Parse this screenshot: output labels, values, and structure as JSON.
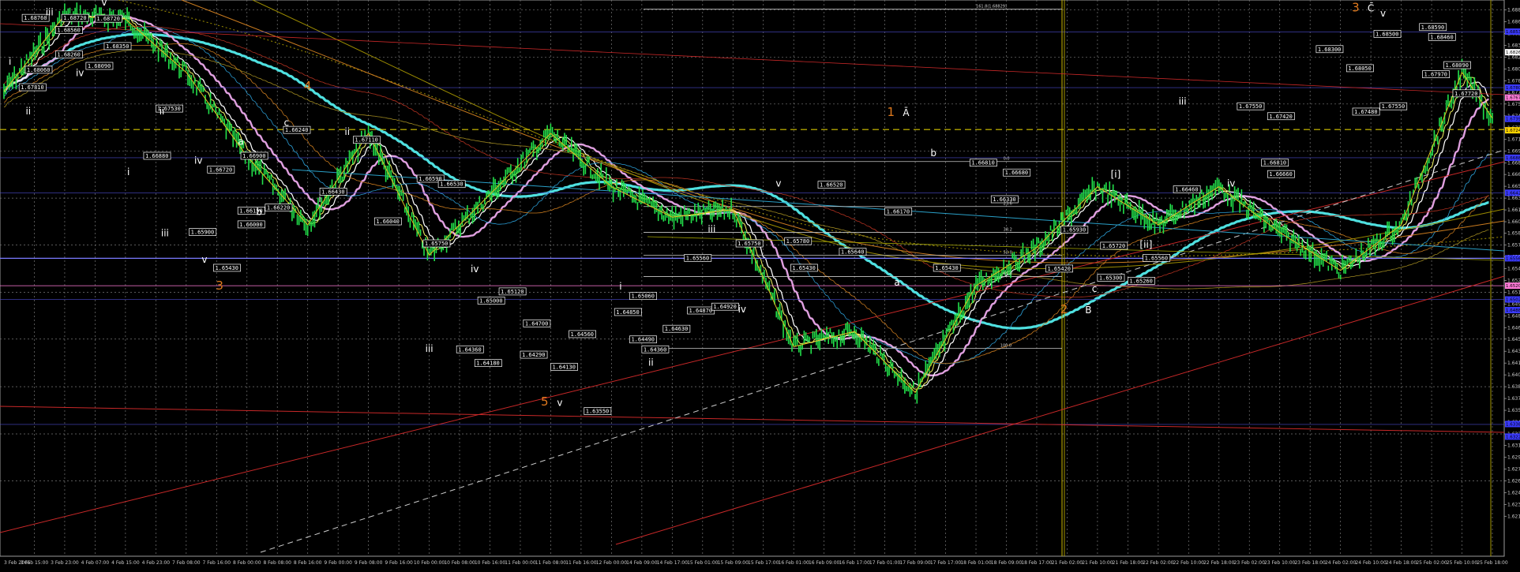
{
  "chart_data": {
    "type": "line",
    "instrument": "GBPUSD-style forex chart (Elliott wave annotated)",
    "xlabel": "",
    "ylabel": "",
    "ylim": [
      1.6165,
      1.6895
    ],
    "grid": true,
    "x_ticks": [
      "3 Feb 2005",
      "3 Feb 15:00",
      "3 Feb 23:00",
      "4 Feb 07:00",
      "4 Feb 15:00",
      "4 Feb 23:00",
      "7 Feb 08:00",
      "7 Feb 16:00",
      "8 Feb 00:00",
      "8 Feb 08:00",
      "8 Feb 16:00",
      "9 Feb 00:00",
      "9 Feb 08:00",
      "9 Feb 16:00",
      "10 Feb 00:00",
      "10 Feb 08:00",
      "10 Feb 16:00",
      "11 Feb 00:00",
      "11 Feb 08:00",
      "11 Feb 16:00",
      "12 Feb 00:00",
      "14 Feb 09:00",
      "14 Feb 17:00",
      "15 Feb 01:00",
      "15 Feb 09:00",
      "15 Feb 17:00",
      "16 Feb 01:00",
      "16 Feb 09:00",
      "16 Feb 17:00",
      "17 Feb 01:00",
      "17 Feb 09:00",
      "17 Feb 17:00",
      "18 Feb 01:00",
      "18 Feb 09:00",
      "18 Feb 17:00",
      "21 Feb 02:00",
      "21 Feb 10:00",
      "21 Feb 18:00",
      "22 Feb 02:00",
      "22 Feb 10:00",
      "22 Feb 18:00",
      "23 Feb 02:00",
      "23 Feb 10:00",
      "23 Feb 18:00",
      "24 Feb 02:00",
      "24 Feb 10:00",
      "24 Feb 18:00",
      "25 Feb 02:00",
      "25 Feb 10:00",
      "25 Feb 18:00"
    ],
    "y_ticks": [
      "1.68820",
      "1.68665",
      "1.68510",
      "1.68355",
      "1.68200",
      "1.68045",
      "1.67890",
      "1.67740",
      "1.67585",
      "1.67430",
      "1.67275",
      "1.67120",
      "1.66965",
      "1.66810",
      "1.66660",
      "1.66505",
      "1.66350",
      "1.66195",
      "1.66040",
      "1.65890",
      "1.65735",
      "1.65580",
      "1.65425",
      "1.65270",
      "1.65115",
      "1.64960",
      "1.64805",
      "1.64650",
      "1.64500",
      "1.64340",
      "1.64185",
      "1.64030",
      "1.63875",
      "1.63720",
      "1.63565",
      "1.63410",
      "1.63255",
      "1.63105",
      "1.62950",
      "1.62795",
      "1.62640",
      "1.62485",
      "1.62330",
      "1.62175"
    ],
    "right_markers": [
      {
        "label": "1.68535",
        "price": 1.68535,
        "color": "#3a3aff"
      },
      {
        "label": "1.68265",
        "price": 1.68265,
        "color": "#ffffff"
      },
      {
        "label": "1.67800",
        "price": 1.678,
        "color": "#3a3aff"
      },
      {
        "label": "1.67670",
        "price": 1.6767,
        "color": "#ff7bd8"
      },
      {
        "label": "1.67390",
        "price": 1.6739,
        "color": "#3a3aff"
      },
      {
        "label": "1.67240",
        "price": 1.6724,
        "color": "#ffd400"
      },
      {
        "label": "1.66880",
        "price": 1.6688,
        "color": "#3a3aff"
      },
      {
        "label": "1.66420",
        "price": 1.6642,
        "color": "#3a3aff"
      },
      {
        "label": "1.65560",
        "price": 1.6556,
        "color": "#3a3aff"
      },
      {
        "label": "1.65200",
        "price": 1.652,
        "color": "#ff7bd8"
      },
      {
        "label": "1.65020",
        "price": 1.6502,
        "color": "#3a3aff"
      },
      {
        "label": "1.64880",
        "price": 1.6488,
        "color": "#3a3aff"
      },
      {
        "label": "1.63385",
        "price": 1.63385,
        "color": "#3a3aff"
      },
      {
        "label": "1.63220",
        "price": 1.6322,
        "color": "#3a3aff"
      }
    ],
    "series": [
      {
        "name": "",
        "color": "#22e04a",
        "x": [
          0,
          2,
          4,
          6,
          8,
          10,
          12,
          14,
          16,
          18,
          20,
          22,
          24,
          26,
          28,
          30,
          32,
          34,
          36,
          38,
          40,
          42,
          44,
          46,
          48,
          49
        ],
        "values": [
          1.6775,
          1.6875,
          1.687,
          1.68,
          1.669,
          1.66,
          1.672,
          1.656,
          1.664,
          1.672,
          1.665,
          1.661,
          1.662,
          1.644,
          1.646,
          1.638,
          1.652,
          1.657,
          1.665,
          1.66,
          1.665,
          1.659,
          1.654,
          1.66,
          1.68,
          1.674
        ]
      }
    ],
    "price_labels": [
      {
        "text": "1.68760",
        "x": 0.6,
        "price": 1.6871
      },
      {
        "text": "1.68720",
        "x": 1.9,
        "price": 1.6871
      },
      {
        "text": "1.68720",
        "x": 3.0,
        "price": 1.687
      },
      {
        "text": "1.68560",
        "x": 1.7,
        "price": 1.6855
      },
      {
        "text": "1.68260",
        "x": 1.7,
        "price": 1.6823
      },
      {
        "text": "1.68090",
        "x": 2.7,
        "price": 1.6808
      },
      {
        "text": "1.68350",
        "x": 3.3,
        "price": 1.6834
      },
      {
        "text": "1.68060",
        "x": 0.7,
        "price": 1.6803
      },
      {
        "text": "1.67810",
        "x": 0.5,
        "price": 1.678
      },
      {
        "text": "1.67530",
        "x": 5.0,
        "price": 1.6752
      },
      {
        "text": "1.66880",
        "x": 4.6,
        "price": 1.669
      },
      {
        "text": "1.66720",
        "x": 6.7,
        "price": 1.6672
      },
      {
        "text": "1.66900",
        "x": 7.8,
        "price": 1.669
      },
      {
        "text": "1.66240",
        "x": 9.2,
        "price": 1.6724
      },
      {
        "text": "1.67110",
        "x": 11.5,
        "price": 1.6711
      },
      {
        "text": "1.66150",
        "x": 7.7,
        "price": 1.6618
      },
      {
        "text": "1.66220",
        "x": 8.6,
        "price": 1.6622
      },
      {
        "text": "1.66000",
        "x": 7.7,
        "price": 1.66
      },
      {
        "text": "1.65900",
        "x": 6.1,
        "price": 1.659
      },
      {
        "text": "1.65430",
        "x": 6.9,
        "price": 1.6543
      },
      {
        "text": "1.66430",
        "x": 10.4,
        "price": 1.6643
      },
      {
        "text": "1.66590",
        "x": 13.6,
        "price": 1.666
      },
      {
        "text": "1.66530",
        "x": 14.3,
        "price": 1.6653
      },
      {
        "text": "1.66040",
        "x": 12.2,
        "price": 1.6604
      },
      {
        "text": "1.65750",
        "x": 13.8,
        "price": 1.6575
      },
      {
        "text": "1.65120",
        "x": 16.3,
        "price": 1.6512
      },
      {
        "text": "1.65000",
        "x": 15.6,
        "price": 1.65
      },
      {
        "text": "1.64180",
        "x": 15.5,
        "price": 1.6418
      },
      {
        "text": "1.64360",
        "x": 14.9,
        "price": 1.6436
      },
      {
        "text": "1.64290",
        "x": 17.0,
        "price": 1.6429
      },
      {
        "text": "1.64700",
        "x": 17.1,
        "price": 1.647
      },
      {
        "text": "1.64560",
        "x": 18.6,
        "price": 1.6456
      },
      {
        "text": "1.64130",
        "x": 18.0,
        "price": 1.6413
      },
      {
        "text": "1.63550",
        "x": 19.1,
        "price": 1.6355
      },
      {
        "text": "1.65060",
        "x": 20.6,
        "price": 1.6506
      },
      {
        "text": "1.64850",
        "x": 20.1,
        "price": 1.6485
      },
      {
        "text": "1.64490",
        "x": 20.6,
        "price": 1.6449
      },
      {
        "text": "1.64360",
        "x": 21.0,
        "price": 1.6436
      },
      {
        "text": "1.64630",
        "x": 21.7,
        "price": 1.6463
      },
      {
        "text": "1.64870",
        "x": 22.5,
        "price": 1.6487
      },
      {
        "text": "1.64920",
        "x": 23.3,
        "price": 1.6492
      },
      {
        "text": "1.65560",
        "x": 22.4,
        "price": 1.6556
      },
      {
        "text": "1.65750",
        "x": 24.1,
        "price": 1.6575
      },
      {
        "text": "1.65430",
        "x": 25.9,
        "price": 1.6543
      },
      {
        "text": "1.65780",
        "x": 25.7,
        "price": 1.6578
      },
      {
        "text": "1.66520",
        "x": 26.8,
        "price": 1.6652
      },
      {
        "text": "1.66170",
        "x": 29.0,
        "price": 1.6617
      },
      {
        "text": "1.65640",
        "x": 27.5,
        "price": 1.6564
      },
      {
        "text": "1.65430",
        "x": 30.6,
        "price": 1.6543
      },
      {
        "text": "1.66810",
        "x": 31.8,
        "price": 1.6681
      },
      {
        "text": "1.66680",
        "x": 32.9,
        "price": 1.6668
      },
      {
        "text": "1.66330",
        "x": 32.5,
        "price": 1.6633
      },
      {
        "text": "1.65930",
        "x": 34.8,
        "price": 1.6593
      },
      {
        "text": "1.65720",
        "x": 36.1,
        "price": 1.6572
      },
      {
        "text": "1.65420",
        "x": 34.3,
        "price": 1.6542
      },
      {
        "text": "1.65300",
        "x": 36.0,
        "price": 1.653
      },
      {
        "text": "1.65260",
        "x": 37.0,
        "price": 1.6526
      },
      {
        "text": "1.65560",
        "x": 37.5,
        "price": 1.6556
      },
      {
        "text": "1.66460",
        "x": 38.5,
        "price": 1.6646
      },
      {
        "text": "1.67550",
        "x": 40.6,
        "price": 1.6755
      },
      {
        "text": "1.67420",
        "x": 41.6,
        "price": 1.6742
      },
      {
        "text": "1.66810",
        "x": 41.4,
        "price": 1.6681
      },
      {
        "text": "1.66660",
        "x": 41.6,
        "price": 1.6666
      },
      {
        "text": "1.68300",
        "x": 43.2,
        "price": 1.683
      },
      {
        "text": "1.68050",
        "x": 44.2,
        "price": 1.6805
      },
      {
        "text": "1.67480",
        "x": 44.4,
        "price": 1.6748
      },
      {
        "text": "1.68500",
        "x": 45.1,
        "price": 1.685
      },
      {
        "text": "1.67550",
        "x": 45.3,
        "price": 1.6755
      },
      {
        "text": "1.68590",
        "x": 46.6,
        "price": 1.6859
      },
      {
        "text": "1.68460",
        "x": 46.9,
        "price": 1.6846
      },
      {
        "text": "1.67970",
        "x": 46.7,
        "price": 1.6797
      },
      {
        "text": "1.68090",
        "x": 47.4,
        "price": 1.6809
      },
      {
        "text": "1.67720",
        "x": 47.7,
        "price": 1.6772
      }
    ],
    "wave_labels": [
      {
        "text": "v",
        "x": 3.3,
        "price": 1.6888,
        "style": "w"
      },
      {
        "text": "iii",
        "x": 1.5,
        "price": 1.6875,
        "style": "w"
      },
      {
        "text": "i",
        "x": 0.2,
        "price": 1.681,
        "style": "w"
      },
      {
        "text": "ii",
        "x": 0.8,
        "price": 1.6745,
        "style": "w"
      },
      {
        "text": "iv",
        "x": 2.5,
        "price": 1.6795,
        "style": "w"
      },
      {
        "text": "i",
        "x": 4.1,
        "price": 1.6665,
        "style": "w"
      },
      {
        "text": "ii",
        "x": 5.2,
        "price": 1.6745,
        "style": "w"
      },
      {
        "text": "iv",
        "x": 6.4,
        "price": 1.668,
        "style": "w"
      },
      {
        "text": "iii",
        "x": 5.3,
        "price": 1.6585,
        "style": "w"
      },
      {
        "text": "v",
        "x": 6.6,
        "price": 1.655,
        "style": "w"
      },
      {
        "text": "a",
        "x": 7.8,
        "price": 1.6705,
        "style": "w"
      },
      {
        "text": "b",
        "x": 8.4,
        "price": 1.6613,
        "style": "w"
      },
      {
        "text": "c",
        "x": 9.3,
        "price": 1.673,
        "style": "w"
      },
      {
        "text": "ii",
        "x": 11.3,
        "price": 1.6718,
        "style": "w"
      },
      {
        "text": "i",
        "x": 10.4,
        "price": 1.663,
        "style": "w"
      },
      {
        "text": "iv",
        "x": 15.5,
        "price": 1.6538,
        "style": "w"
      },
      {
        "text": "iii",
        "x": 14.0,
        "price": 1.6433,
        "style": "w"
      },
      {
        "text": "v",
        "x": 18.3,
        "price": 1.6362,
        "style": "w"
      },
      {
        "text": "i",
        "x": 20.3,
        "price": 1.6515,
        "style": "w"
      },
      {
        "text": "ii",
        "x": 21.3,
        "price": 1.6415,
        "style": "w"
      },
      {
        "text": "iii",
        "x": 23.3,
        "price": 1.659,
        "style": "w"
      },
      {
        "text": "iv",
        "x": 24.3,
        "price": 1.6485,
        "style": "w"
      },
      {
        "text": "v",
        "x": 25.5,
        "price": 1.665,
        "style": "w"
      },
      {
        "text": "a",
        "x": 29.4,
        "price": 1.652,
        "style": "w"
      },
      {
        "text": "b",
        "x": 30.6,
        "price": 1.669,
        "style": "w"
      },
      {
        "text": "c",
        "x": 35.9,
        "price": 1.6512,
        "style": "w"
      },
      {
        "text": "iii",
        "x": 38.8,
        "price": 1.6758,
        "style": "w"
      },
      {
        "text": "iv",
        "x": 40.4,
        "price": 1.665,
        "style": "w"
      },
      {
        "text": "v",
        "x": 45.4,
        "price": 1.6873,
        "style": "w"
      },
      {
        "text": "[i]",
        "x": 36.6,
        "price": 1.6662,
        "style": "w"
      },
      {
        "text": "[ii]",
        "x": 37.6,
        "price": 1.657,
        "style": "w"
      },
      {
        "text": "Ā",
        "x": 29.7,
        "price": 1.6743,
        "style": "w"
      },
      {
        "text": "B̄",
        "x": 35.7,
        "price": 1.6484,
        "style": "w"
      },
      {
        "text": "C̄",
        "x": 45.0,
        "price": 1.688,
        "style": "w"
      },
      {
        "text": "4",
        "x": 10.0,
        "price": 1.6777,
        "style": "o"
      },
      {
        "text": "3",
        "x": 7.1,
        "price": 1.6515,
        "style": "o"
      },
      {
        "text": "5",
        "x": 17.8,
        "price": 1.6363,
        "style": "o"
      },
      {
        "text": "1",
        "x": 29.2,
        "price": 1.6743,
        "style": "o"
      },
      {
        "text": "2",
        "x": 34.9,
        "price": 1.6484,
        "style": "o"
      },
      {
        "text": "3",
        "x": 44.5,
        "price": 1.688,
        "style": "o"
      }
    ],
    "fib_labels": [
      {
        "text": "161.8(1.68829)",
        "x": 32.0,
        "price": 1.68829
      },
      {
        "text": "0.0",
        "x": 32.9,
        "price": 1.6683
      },
      {
        "text": "23.6",
        "x": 32.9,
        "price": 1.6624
      },
      {
        "text": "38.2",
        "x": 32.9,
        "price": 1.659
      },
      {
        "text": "50.0",
        "x": 32.9,
        "price": 1.656
      },
      {
        "text": "61.8",
        "x": 32.9,
        "price": 1.6532
      },
      {
        "text": "100.0",
        "x": 32.8,
        "price": 1.6438
      }
    ]
  }
}
